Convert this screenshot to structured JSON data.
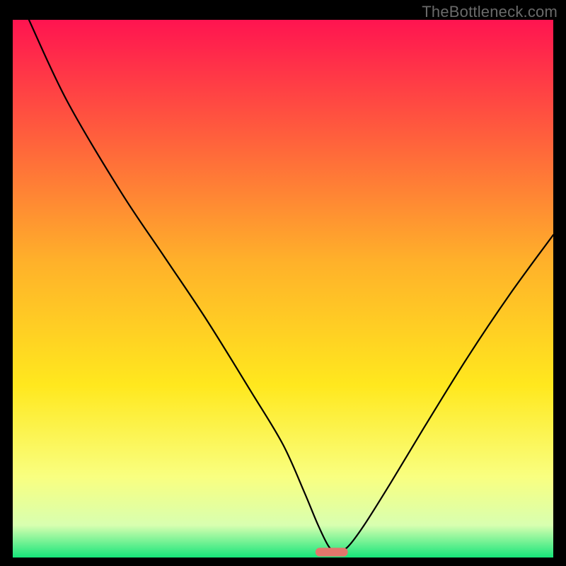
{
  "watermark": "TheBottleneck.com",
  "colors": {
    "gradient_top": "#ff1450",
    "gradient_mid_upper": "#ff593e",
    "gradient_mid": "#ffb12a",
    "gradient_mid_lower": "#ffe81e",
    "gradient_low": "#f9ff80",
    "gradient_base_fade": "#d8ffb0",
    "gradient_bottom": "#16e57a",
    "curve": "#000000",
    "marker": "#e2766c",
    "background": "#000000"
  },
  "chart_data": {
    "type": "line",
    "title": "",
    "xlabel": "",
    "ylabel": "",
    "xlim": [
      0,
      100
    ],
    "ylim": [
      0,
      100
    ],
    "x": [
      3,
      10,
      20,
      28,
      36,
      44,
      50,
      54,
      56.5,
      58.5,
      60,
      62,
      65,
      70,
      76,
      84,
      92,
      100
    ],
    "values": [
      100,
      85,
      68,
      56,
      44,
      31,
      21,
      12,
      6,
      2,
      1,
      2,
      6,
      14,
      24,
      37,
      49,
      60
    ],
    "marker": {
      "x": 59,
      "y": 1,
      "width": 6,
      "height": 1.6
    },
    "notes": "V-shaped bottleneck curve over vertical rainbow gradient; minimum near x≈59; right branch rises to ~60% at x=100; left branch starts at 100% at x≈3."
  }
}
